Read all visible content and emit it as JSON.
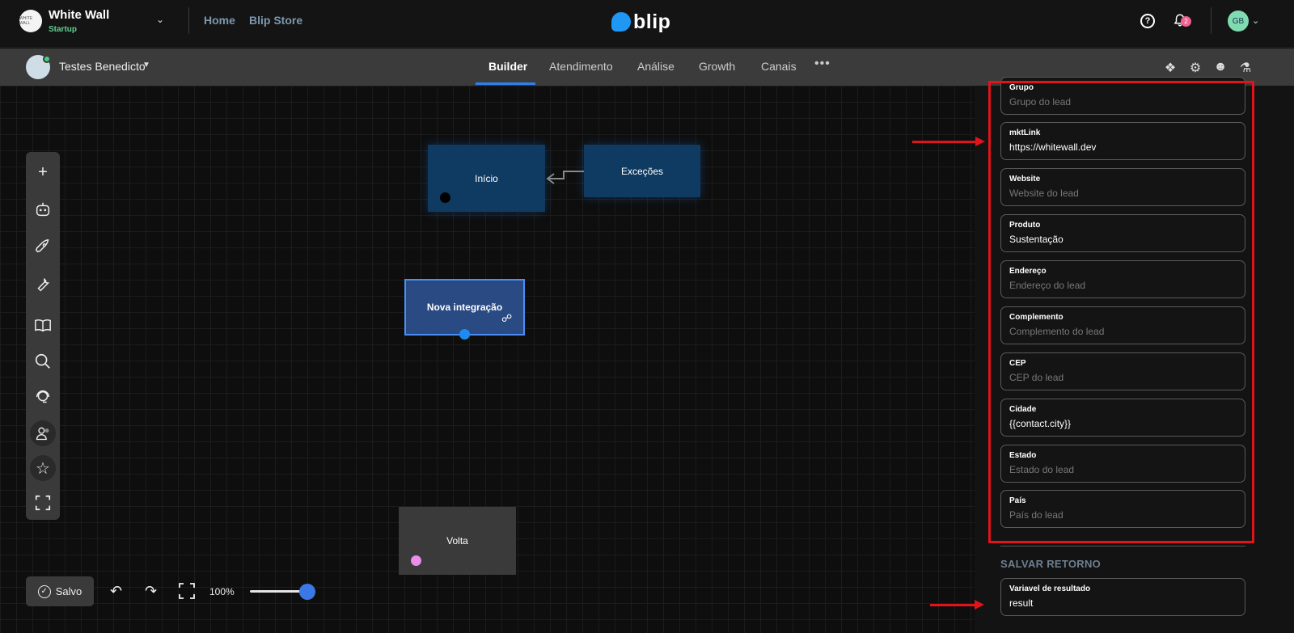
{
  "org": {
    "name": "White Wall",
    "plan": "Startup",
    "logo_text": "WHITE WALL"
  },
  "topnav": {
    "links": [
      "Home",
      "Blip Store"
    ],
    "brand": "blip",
    "notifications": "2",
    "user_initials": "GB"
  },
  "botbar": {
    "bot_name": "Testes Benedicto",
    "tabs": [
      "Builder",
      "Atendimento",
      "Análise",
      "Growth",
      "Canais"
    ],
    "more": "•••"
  },
  "canvas": {
    "blocks": {
      "start": "Início",
      "exceptions": "Exceções",
      "integration": "Nova integração",
      "back": "Volta"
    }
  },
  "bottom": {
    "saved": "Salvo",
    "zoom": "100%",
    "zoom_level": 1.0
  },
  "panel": {
    "fields": [
      {
        "label": "Grupo",
        "value": "Grupo do lead",
        "placeholder": true
      },
      {
        "label": "mktLink",
        "value": "https://whitewall.dev",
        "placeholder": false
      },
      {
        "label": "Website",
        "value": "Website do lead",
        "placeholder": true
      },
      {
        "label": "Produto",
        "value": "Sustentação",
        "placeholder": false
      },
      {
        "label": "Endereço",
        "value": "Endereço do lead",
        "placeholder": true
      },
      {
        "label": "Complemento",
        "value": "Complemento do lead",
        "placeholder": true
      },
      {
        "label": "CEP",
        "value": "CEP do lead",
        "placeholder": true
      },
      {
        "label": "Cidade",
        "value": "{{contact.city}}",
        "placeholder": false
      },
      {
        "label": "Estado",
        "value": "Estado do lead",
        "placeholder": true
      },
      {
        "label": "País",
        "value": "País do lead",
        "placeholder": true
      }
    ],
    "section_title": "SALVAR RETORNO",
    "result_field": {
      "label": "Variavel de resultado",
      "value": "result"
    }
  },
  "colors": {
    "accent": "#2f80ed",
    "annotation": "#e0141a",
    "plan": "#5fd08e"
  }
}
